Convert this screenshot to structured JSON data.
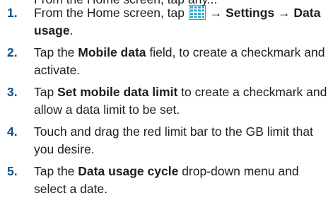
{
  "header_fragment": "From the Home screen, tap any...",
  "icons": {
    "apps_grid": "apps-grid-icon",
    "apps_grid_color": "#2aa7c9"
  },
  "colors": {
    "step_number": "#0a4f8a",
    "text": "#1e1e1e"
  },
  "steps": [
    {
      "num": "1.",
      "parts": {
        "a": "From the Home screen, tap",
        "arrow1": "→",
        "b": "Settings",
        "arrow2": "→",
        "c": "Data usage",
        "d": "."
      }
    },
    {
      "num": "2.",
      "parts": {
        "a": "Tap the",
        "b": "Mobile data",
        "c": "field, to create a checkmark and activate."
      }
    },
    {
      "num": "3.",
      "parts": {
        "a": "Tap",
        "b": "Set mobile data limit",
        "c": "to create a checkmark and allow a data limit to be set."
      }
    },
    {
      "num": "4.",
      "parts": {
        "a": "Touch and drag the red limit bar to the GB limit that you desire."
      }
    },
    {
      "num": "5.",
      "parts": {
        "a": "Tap the",
        "b": "Data usage cycle",
        "c": "drop-down menu and select a date."
      }
    }
  ]
}
